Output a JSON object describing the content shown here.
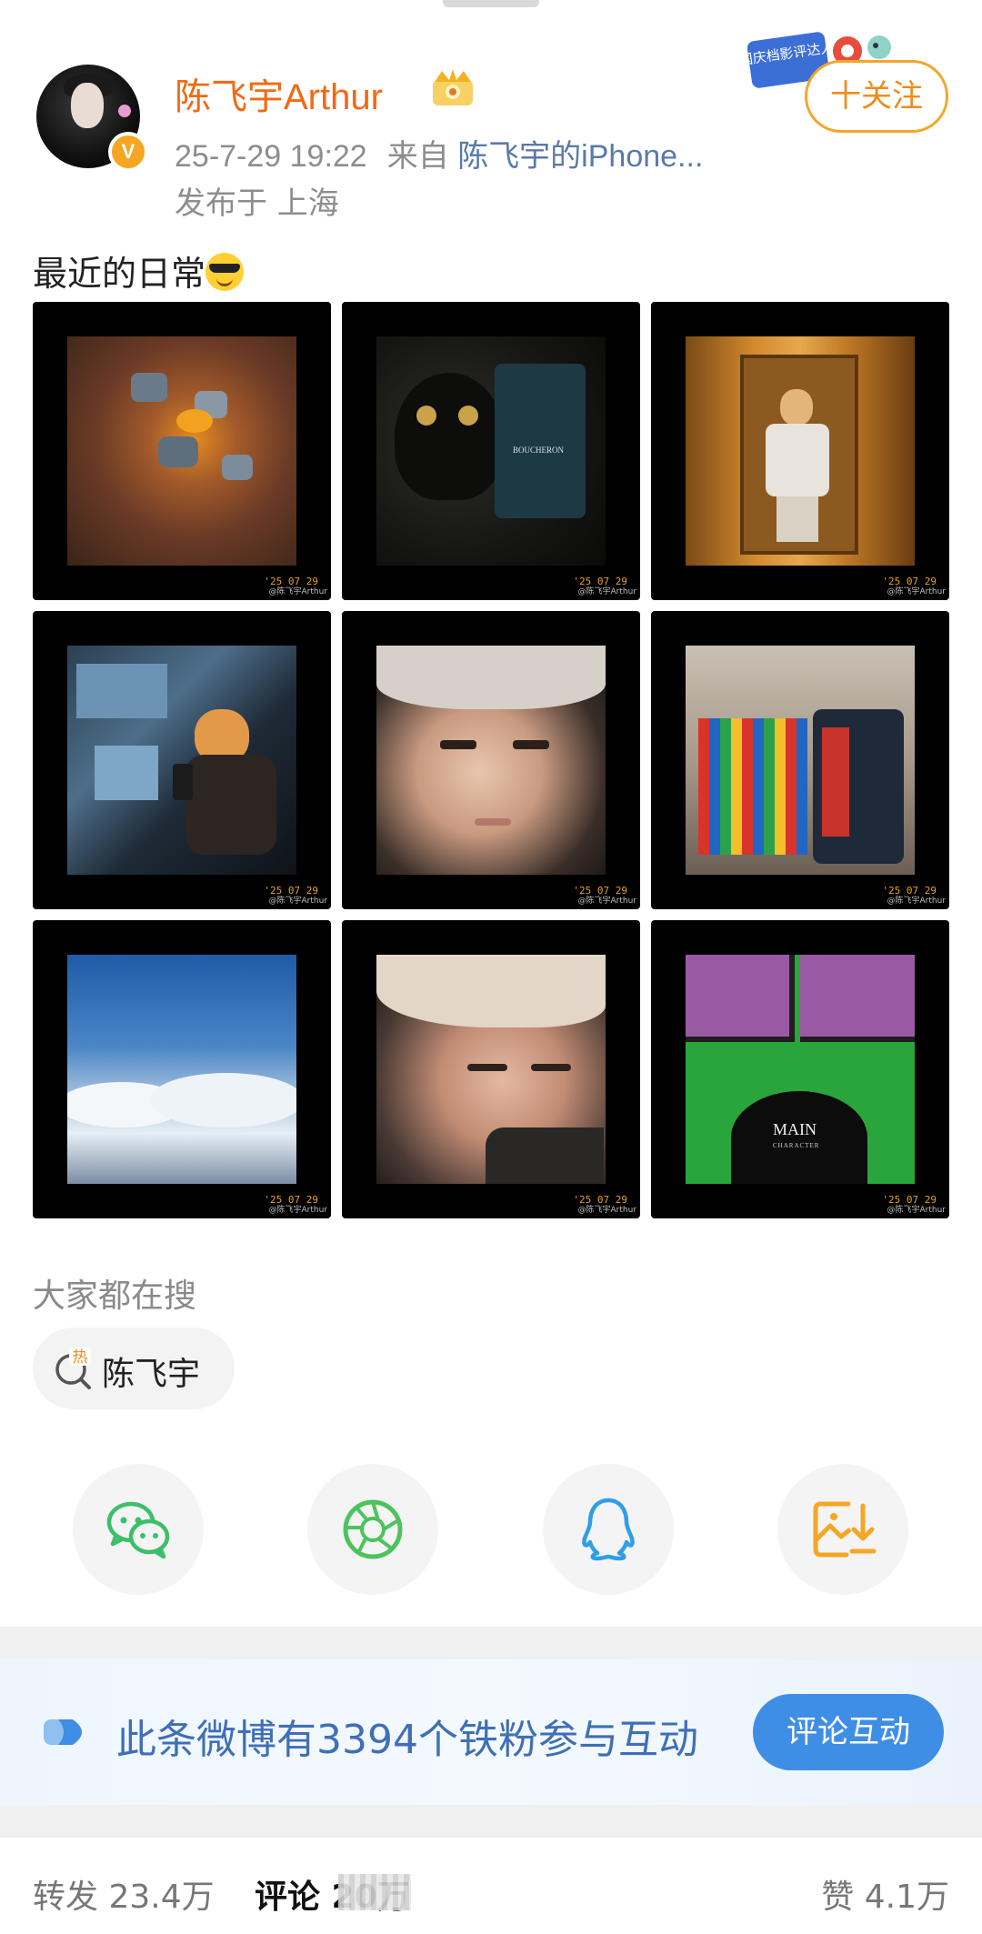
{
  "header": {
    "username": "陈飞宇Arthur",
    "timestamp": "25-7-29 19:22",
    "from_label": "来自",
    "device": "陈飞宇的iPhone...",
    "location": "发布于 上海",
    "follow_label": "十关注",
    "event_badge": "国庆档影评达人",
    "verified_badge": "V"
  },
  "post": {
    "text": "最近的日常",
    "emoji": "sunglasses-face"
  },
  "images": [
    {
      "date": "'25 07 29",
      "watermark": "@陈飞宇Arthur"
    },
    {
      "date": "'25 07 29",
      "watermark": "@陈飞宇Arthur",
      "sign": "BOUCHERON"
    },
    {
      "date": "'25 07 29",
      "watermark": "@陈飞宇Arthur"
    },
    {
      "date": "'25 07 29",
      "watermark": "@陈飞宇Arthur"
    },
    {
      "date": "'25 07 29",
      "watermark": "@陈飞宇Arthur"
    },
    {
      "date": "'25 07 29",
      "watermark": "@陈飞宇Arthur"
    },
    {
      "date": "'25 07 29",
      "watermark": "@陈飞宇Arthur"
    },
    {
      "date": "'25 07 29",
      "watermark": "@陈飞宇Arthur"
    },
    {
      "date": "'25 07 29",
      "watermark": "@陈飞宇Arthur",
      "cap_main": "MAIN",
      "cap_sub": "CHARACTER"
    }
  ],
  "search": {
    "title": "大家都在搜",
    "chip_label": "陈飞宇",
    "chip_icon_text": "热"
  },
  "share": [
    "wechat-icon",
    "moments-icon",
    "qq-icon",
    "save-image-icon"
  ],
  "fans": {
    "text": "此条微博有3394个铁粉参与互动",
    "button": "评论互动"
  },
  "tabs": {
    "repost": "转发 23.4万",
    "comment": "评论 20万",
    "like": "赞 4.1万"
  },
  "colors": {
    "username": "#f06a14",
    "follow": "#f08c1a",
    "link": "#5a7aa8",
    "fans_text": "#3f6fb6",
    "fans_button": "#3f8ee6"
  }
}
